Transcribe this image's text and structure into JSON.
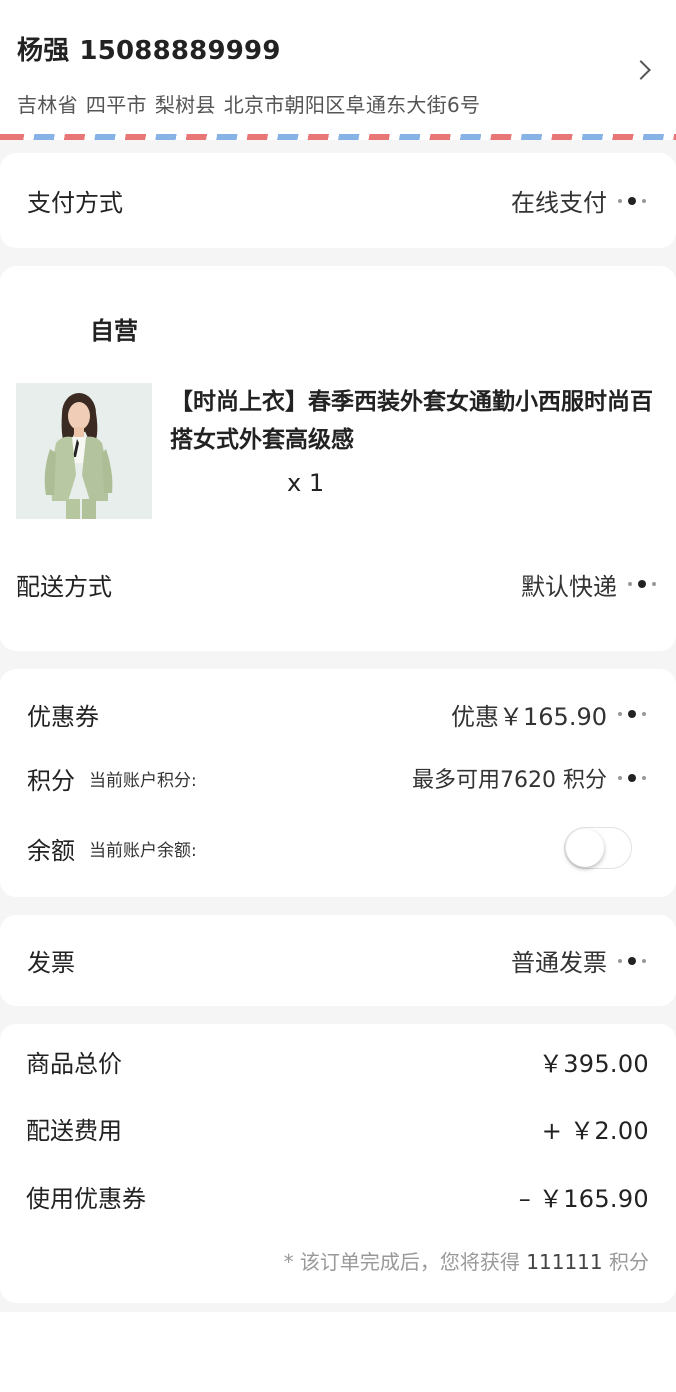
{
  "address": {
    "name": "杨强",
    "phone": "15088889999",
    "province": "吉林省",
    "city": "四平市",
    "county": "梨树县",
    "detail": "北京市朝阳区阜通东大街6号"
  },
  "payment": {
    "label": "支付方式",
    "value": "在线支付"
  },
  "store": {
    "name": "自营",
    "product": {
      "title": "【时尚上衣】春季西装外套女通勤小西服时尚百搭女式外套高级感",
      "qty": "x 1"
    },
    "delivery": {
      "label": "配送方式",
      "value": "默认快递"
    }
  },
  "discounts": {
    "coupon": {
      "label": "优惠券",
      "value": "优惠￥165.90"
    },
    "points": {
      "label": "积分",
      "sub": "当前账户积分:",
      "value": "最多可用7620 积分"
    },
    "balance": {
      "label": "余额",
      "sub": "当前账户余额:",
      "enabled": false
    }
  },
  "invoice": {
    "label": "发票",
    "value": "普通发票"
  },
  "summary": {
    "goods_total_label": "商品总价",
    "goods_total": "￥395.00",
    "shipping_label": "配送费用",
    "shipping": "+ ￥2.00",
    "coupon_label": "使用优惠券",
    "coupon": "– ￥165.90",
    "note_prefix": "* 该订单完成后，您将获得",
    "note_points": "111111",
    "note_suffix": "积分"
  },
  "colors": {
    "airmail_red": "#e87676",
    "airmail_blue": "#86b2e6",
    "product_jacket": "#b8c8a2"
  },
  "icons": [
    "chevron-right-icon",
    "more-dots-icon"
  ]
}
